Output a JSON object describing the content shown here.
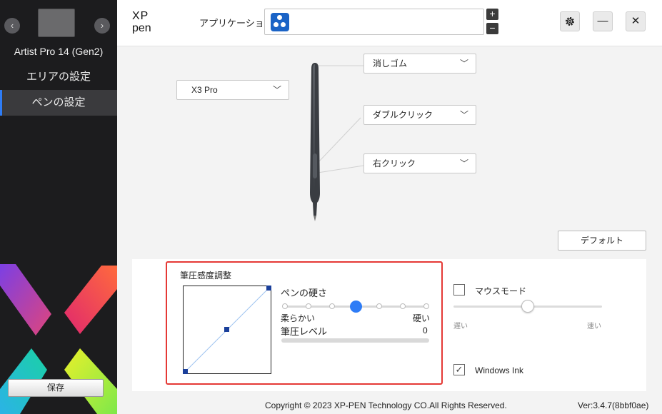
{
  "sidebar": {
    "device_name": "Artist Pro 14 (Gen2)",
    "prev_glyph": "‹",
    "next_glyph": "›",
    "items": [
      {
        "label": "エリアの設定",
        "active": false
      },
      {
        "label": "ペンの設定",
        "active": true
      }
    ],
    "save_label": "保存",
    "accent": "#2e7cf6"
  },
  "header": {
    "logo_icon": "xp-pen-logo",
    "application_label": "アプリケーション:",
    "app_icon": "all-apps-icon",
    "plus_label": "+",
    "minus_label": "−",
    "settings_icon": "gear-icon",
    "minimize_glyph": "—",
    "close_glyph": "✕"
  },
  "pen": {
    "model": "X3 Pro",
    "buttons": [
      {
        "label": "消しゴム"
      },
      {
        "label": "ダブルクリック"
      },
      {
        "label": "右クリック"
      }
    ],
    "default_label": "デフォルト"
  },
  "pressure": {
    "title": "筆圧感度調整",
    "hardness_label": "ペンの硬さ",
    "hardness_steps": 7,
    "hardness_index": 3,
    "soft_label": "柔らかい",
    "hard_label": "硬い",
    "level_label": "筆圧レベル",
    "level_value": "0",
    "level_fraction": 0
  },
  "mouse_mode": {
    "label": "マウスモード",
    "checked": false,
    "speed_fraction": 0.5,
    "slow_label": "遅い",
    "fast_label": "速い"
  },
  "windows_ink": {
    "label": "Windows Ink",
    "checked": true,
    "check_glyph": "✓"
  },
  "footer": {
    "copyright": "Copyright © 2023  XP-PEN Technology CO.All Rights Reserved.",
    "version": "Ver:3.4.7(8bbf0ae)"
  }
}
